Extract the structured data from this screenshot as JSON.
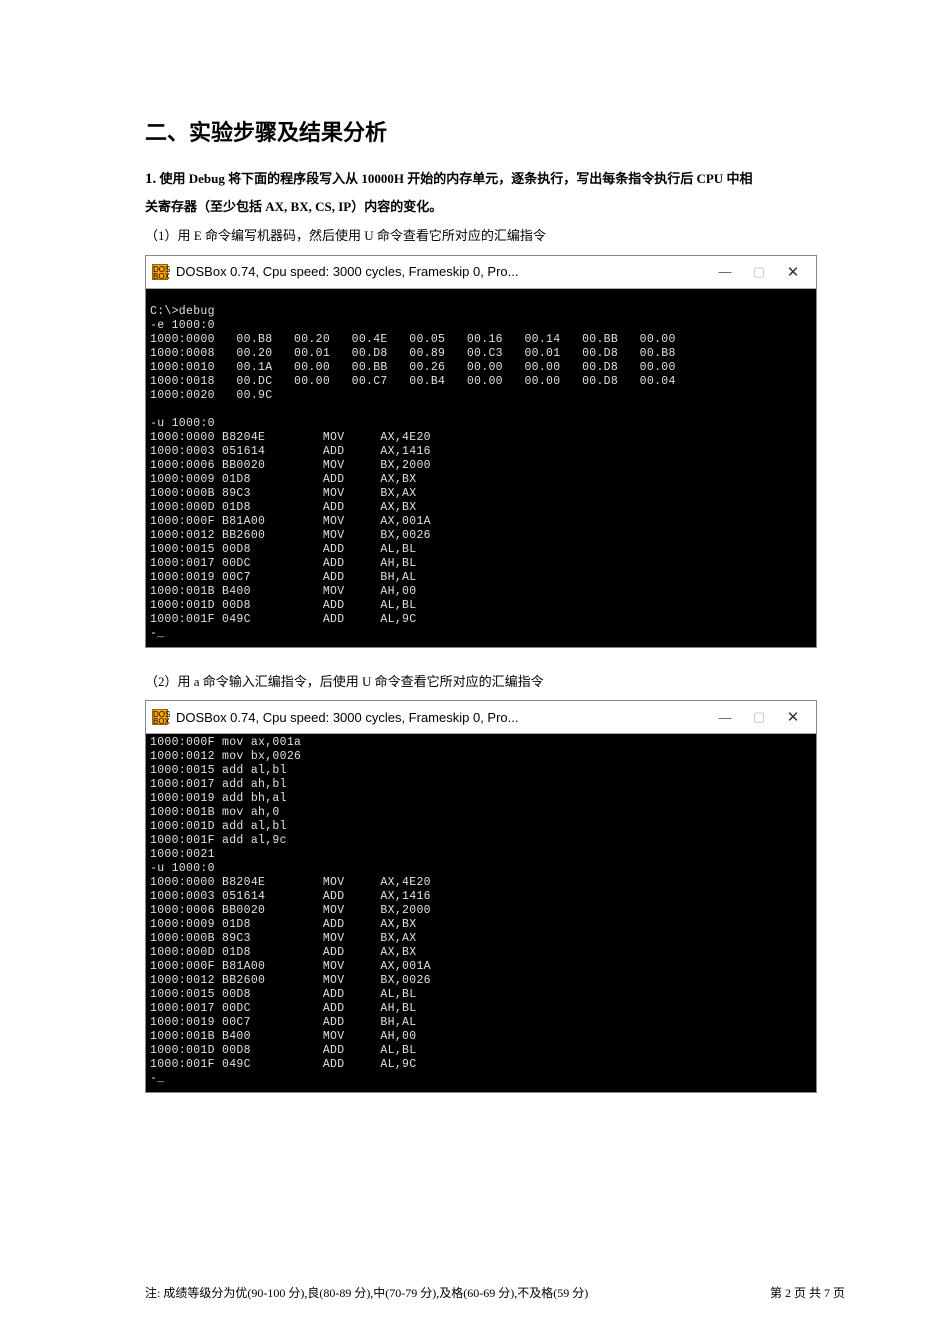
{
  "heading": "二、实验步骤及结果分析",
  "question1": {
    "number": "1.",
    "body": "使用 Debug 将下面的程序段写入从 10000H 开始的内存单元，逐条执行，写出每条指令执行后 CPU 中相",
    "body_line2": "关寄存器（至少包括 AX, BX, CS, IP）内容的变化。"
  },
  "sub1": "（1）用 E 命令编写机器码，然后使用 U 命令查看它所对应的汇编指令",
  "sub2": "（2）用 a 命令输入汇编指令，后使用 U 命令查看它所对应的汇编指令",
  "window1": {
    "title": "DOSBox 0.74, Cpu speed:    3000 cycles, Frameskip  0, Pro...",
    "min": "—",
    "max": "▢",
    "close": "✕",
    "lines": [
      "",
      "C:\\>debug",
      "-e 1000:0",
      "1000:0000   00.B8   00.20   00.4E   00.05   00.16   00.14   00.BB   00.00",
      "1000:0008   00.20   00.01   00.D8   00.89   00.C3   00.01   00.D8   00.B8",
      "1000:0010   00.1A   00.00   00.BB   00.26   00.00   00.00   00.D8   00.00",
      "1000:0018   00.DC   00.00   00.C7   00.B4   00.00   00.00   00.D8   00.04",
      "1000:0020   00.9C",
      "",
      "-u 1000:0",
      "1000:0000 B8204E        MOV     AX,4E20",
      "1000:0003 051614        ADD     AX,1416",
      "1000:0006 BB0020        MOV     BX,2000",
      "1000:0009 01D8          ADD     AX,BX",
      "1000:000B 89C3          MOV     BX,AX",
      "1000:000D 01D8          ADD     AX,BX",
      "1000:000F B81A00        MOV     AX,001A",
      "1000:0012 BB2600        MOV     BX,0026",
      "1000:0015 00D8          ADD     AL,BL",
      "1000:0017 00DC          ADD     AH,BL",
      "1000:0019 00C7          ADD     BH,AL",
      "1000:001B B400          MOV     AH,00",
      "1000:001D 00D8          ADD     AL,BL",
      "1000:001F 049C          ADD     AL,9C",
      "-_"
    ]
  },
  "window2": {
    "title": "DOSBox 0.74, Cpu speed:    3000 cycles, Frameskip  0, Pro...",
    "min": "—",
    "max": "▢",
    "close": "✕",
    "lines": [
      "1000:000F mov ax,001a",
      "1000:0012 mov bx,0026",
      "1000:0015 add al,bl",
      "1000:0017 add ah,bl",
      "1000:0019 add bh,al",
      "1000:001B mov ah,0",
      "1000:001D add al,bl",
      "1000:001F add al,9c",
      "1000:0021",
      "-u 1000:0",
      "1000:0000 B8204E        MOV     AX,4E20",
      "1000:0003 051614        ADD     AX,1416",
      "1000:0006 BB0020        MOV     BX,2000",
      "1000:0009 01D8          ADD     AX,BX",
      "1000:000B 89C3          MOV     BX,AX",
      "1000:000D 01D8          ADD     AX,BX",
      "1000:000F B81A00        MOV     AX,001A",
      "1000:0012 BB2600        MOV     BX,0026",
      "1000:0015 00D8          ADD     AL,BL",
      "1000:0017 00DC          ADD     AH,BL",
      "1000:0019 00C7          ADD     BH,AL",
      "1000:001B B400          MOV     AH,00",
      "1000:001D 00D8          ADD     AL,BL",
      "1000:001F 049C          ADD     AL,9C",
      "-_"
    ]
  },
  "footer": {
    "left": "注: 成绩等级分为优(90-100 分),良(80-89 分),中(70-79 分),及格(60-69 分),不及格(59 分)",
    "right": "第 2 页 共 7 页"
  }
}
